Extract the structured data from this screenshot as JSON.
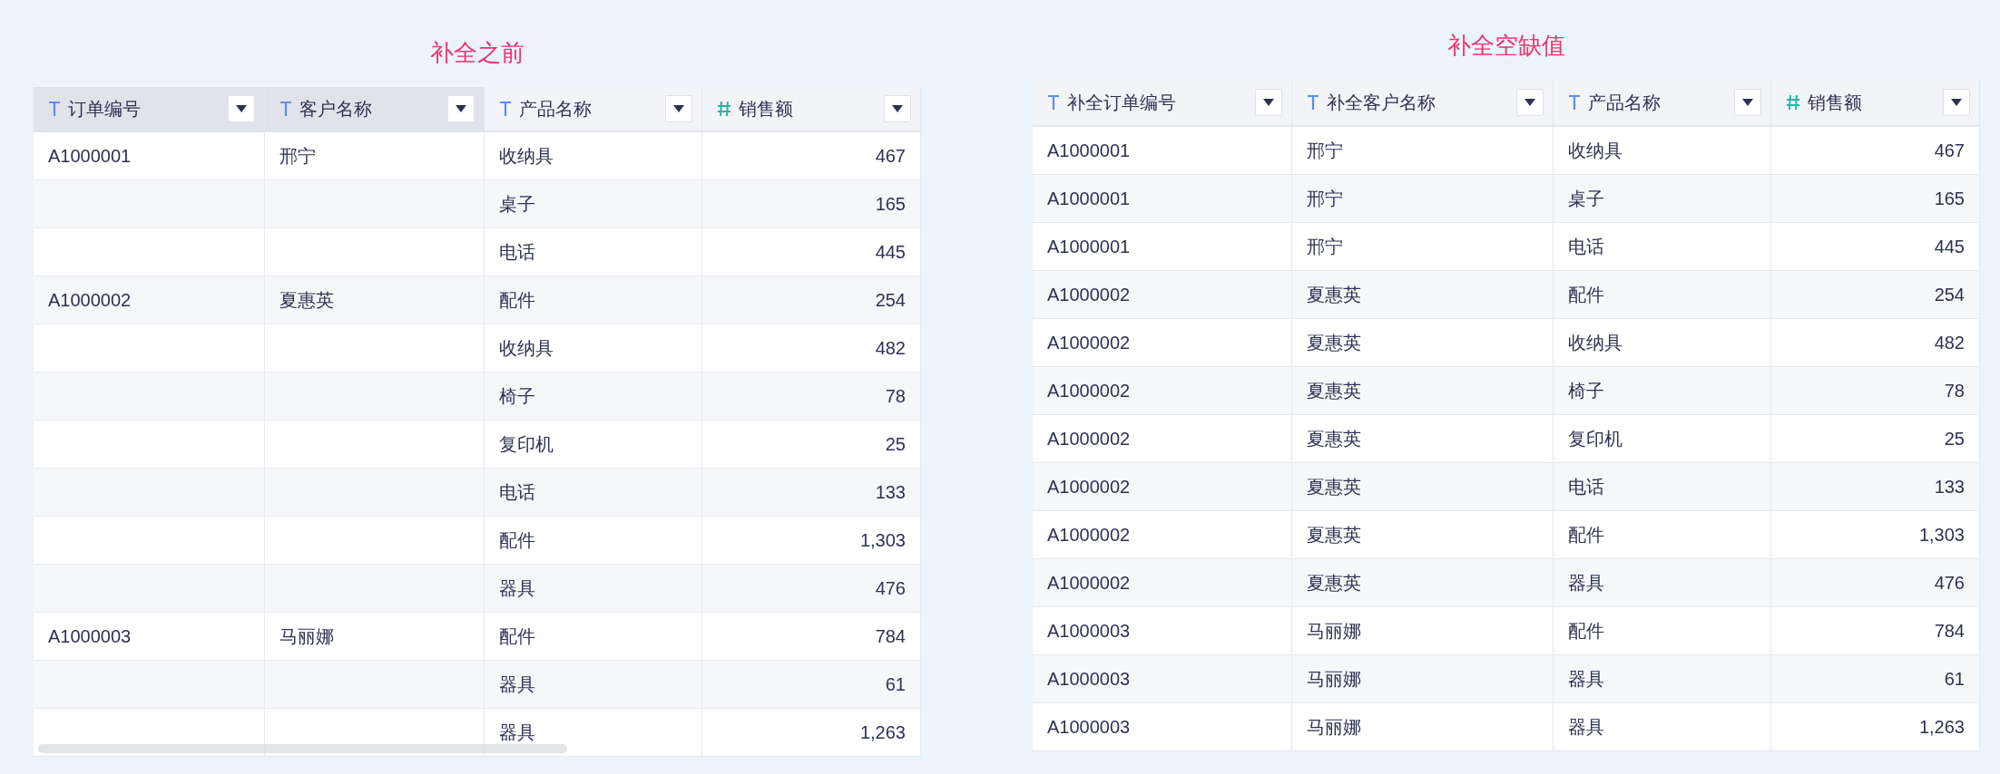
{
  "panels": [
    {
      "title": "补全之前",
      "scrollbar": true,
      "columns": [
        {
          "kind": "text",
          "label": "订单编号",
          "selected": true
        },
        {
          "kind": "text",
          "label": "客户名称",
          "selected": true
        },
        {
          "kind": "text",
          "label": "产品名称",
          "selected": false
        },
        {
          "kind": "number",
          "label": "销售额",
          "selected": false
        }
      ],
      "rows": [
        [
          "A1000001",
          "邢宁",
          "收纳具",
          "467"
        ],
        [
          null,
          null,
          "桌子",
          "165"
        ],
        [
          null,
          null,
          "电话",
          "445"
        ],
        [
          "A1000002",
          "夏惠英",
          "配件",
          "254"
        ],
        [
          null,
          null,
          "收纳具",
          "482"
        ],
        [
          null,
          null,
          "椅子",
          "78"
        ],
        [
          null,
          null,
          "复印机",
          "25"
        ],
        [
          null,
          null,
          "电话",
          "133"
        ],
        [
          null,
          null,
          "配件",
          "1,303"
        ],
        [
          null,
          null,
          "器具",
          "476"
        ],
        [
          "A1000003",
          "马丽娜",
          "配件",
          "784"
        ],
        [
          null,
          null,
          "器具",
          "61"
        ],
        [
          null,
          null,
          "器具",
          "1,263"
        ]
      ]
    },
    {
      "title": "补全空缺值",
      "columns": [
        {
          "kind": "text",
          "label": "补全订单编号",
          "selected": false
        },
        {
          "kind": "text",
          "label": "补全客户名称",
          "selected": false
        },
        {
          "kind": "text",
          "label": "产品名称",
          "selected": false
        },
        {
          "kind": "number",
          "label": "销售额",
          "selected": false
        }
      ],
      "rows": [
        [
          "A1000001",
          "邢宁",
          "收纳具",
          "467"
        ],
        [
          "A1000001",
          "邢宁",
          "桌子",
          "165"
        ],
        [
          "A1000001",
          "邢宁",
          "电话",
          "445"
        ],
        [
          "A1000002",
          "夏惠英",
          "配件",
          "254"
        ],
        [
          "A1000002",
          "夏惠英",
          "收纳具",
          "482"
        ],
        [
          "A1000002",
          "夏惠英",
          "椅子",
          "78"
        ],
        [
          "A1000002",
          "夏惠英",
          "复印机",
          "25"
        ],
        [
          "A1000002",
          "夏惠英",
          "电话",
          "133"
        ],
        [
          "A1000002",
          "夏惠英",
          "配件",
          "1,303"
        ],
        [
          "A1000002",
          "夏惠英",
          "器具",
          "476"
        ],
        [
          "A1000003",
          "马丽娜",
          "配件",
          "784"
        ],
        [
          "A1000003",
          "马丽娜",
          "器具",
          "61"
        ],
        [
          "A1000003",
          "马丽娜",
          "器具",
          "1,263"
        ]
      ]
    }
  ]
}
